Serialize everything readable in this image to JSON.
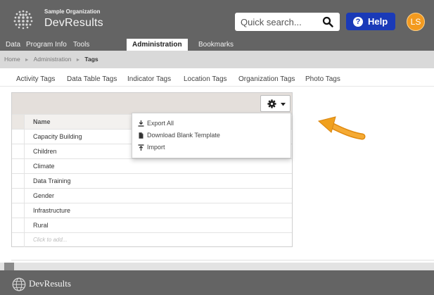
{
  "header": {
    "org_name": "Sample Organization",
    "app_name": "DevResults",
    "search_placeholder": "Quick search...",
    "help_label": "Help",
    "avatar_initials": "LS",
    "colors": {
      "bar": "#646464",
      "help": "#1a3ab8",
      "avatar": "#f39a1f"
    }
  },
  "nav": {
    "items": [
      "Data",
      "Program Info",
      "Tools",
      "Administration",
      "Bookmarks"
    ],
    "active": "Administration"
  },
  "breadcrumb": [
    "Home",
    "Administration",
    "Tags"
  ],
  "tabs": [
    "Activity Tags",
    "Data Table Tags",
    "Indicator Tags",
    "Location Tags",
    "Organization Tags",
    "Photo Tags"
  ],
  "grid": {
    "column_header": "Name",
    "rows": [
      "Capacity Building",
      "Children",
      "Climate",
      "Data Training",
      "Gender",
      "Infrastructure",
      "Rural"
    ],
    "add_placeholder": "Click to add..."
  },
  "dropdown": {
    "items": [
      {
        "label": "Export All",
        "icon": "download-icon"
      },
      {
        "label": "Download Blank Template",
        "icon": "file-icon"
      },
      {
        "label": "Import",
        "icon": "upload-icon"
      }
    ]
  },
  "annotation": {
    "arrow_color": "#f0a01e"
  },
  "footer": {
    "app_name": "DevResults"
  }
}
